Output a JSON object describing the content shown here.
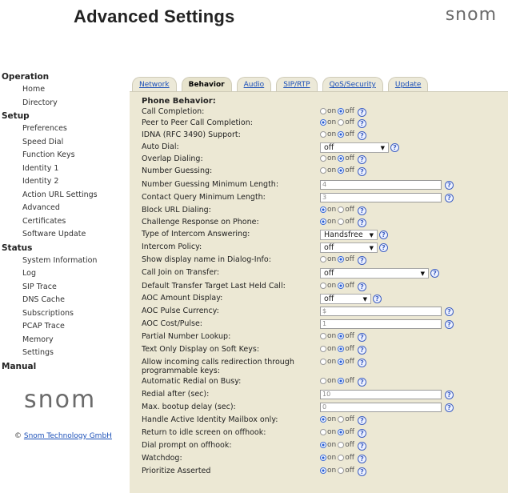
{
  "header": {
    "title": "Advanced Settings",
    "brand": "snom"
  },
  "sidebar": {
    "sections": [
      {
        "label": "Operation",
        "items": [
          "Home",
          "Directory"
        ]
      },
      {
        "label": "Setup",
        "items": [
          "Preferences",
          "Speed Dial",
          "Function Keys",
          "Identity 1",
          "Identity 2",
          "Action URL Settings",
          "Advanced",
          "Certificates",
          "Software Update"
        ]
      },
      {
        "label": "Status",
        "items": [
          "System Information",
          "Log",
          "SIP Trace",
          "DNS Cache",
          "Subscriptions",
          "PCAP Trace",
          "Memory",
          "Settings"
        ]
      },
      {
        "label": "Manual",
        "items": []
      }
    ],
    "logo": "snom",
    "copyright_symbol": "©",
    "copyright_link": "Snom Technology GmbH"
  },
  "tabs": [
    {
      "label": "Network",
      "active": false
    },
    {
      "label": "Behavior",
      "active": true
    },
    {
      "label": "Audio",
      "active": false
    },
    {
      "label": "SIP/RTP",
      "active": false
    },
    {
      "label": "QoS/Security",
      "active": false
    },
    {
      "label": "Update",
      "active": false
    }
  ],
  "section_title": "Phone Behavior:",
  "radio_labels": {
    "on": "on",
    "off": "off"
  },
  "help_glyph": "?",
  "settings": [
    {
      "label": "Call Completion:",
      "type": "radio",
      "value": "off"
    },
    {
      "label": "Peer to Peer Call Completion:",
      "type": "radio",
      "value": "on"
    },
    {
      "label": "IDNA (RFC 3490) Support:",
      "type": "radio",
      "value": "off"
    },
    {
      "label": "Auto Dial:",
      "type": "select",
      "value": "off"
    },
    {
      "label": "Overlap Dialing:",
      "type": "radio",
      "value": "off"
    },
    {
      "label": "Number Guessing:",
      "type": "radio",
      "value": "off"
    },
    {
      "label": "Number Guessing Minimum Length:",
      "type": "text",
      "value": "4"
    },
    {
      "label": "Contact Query Minimum Length:",
      "type": "text",
      "value": "3"
    },
    {
      "label": "Block URL Dialing:",
      "type": "radio",
      "value": "on"
    },
    {
      "label": "Challenge Response on Phone:",
      "type": "radio",
      "value": "on"
    },
    {
      "label": "Type of Intercom Answering:",
      "type": "select",
      "value": "Handsfree"
    },
    {
      "label": "Intercom Policy:",
      "type": "select",
      "value": "off"
    },
    {
      "label": "Show display name in Dialog-Info:",
      "type": "radio",
      "value": "off"
    },
    {
      "label": "Call Join on Transfer:",
      "type": "select",
      "value": "off"
    },
    {
      "label": "Default Transfer Target Last Held Call:",
      "type": "radio",
      "value": "off"
    },
    {
      "label": "AOC Amount Display:",
      "type": "select",
      "value": "off"
    },
    {
      "label": "AOC Pulse Currency:",
      "type": "text",
      "value": "$"
    },
    {
      "label": "AOC Cost/Pulse:",
      "type": "text",
      "value": "1"
    },
    {
      "label": "Partial Number Lookup:",
      "type": "radio",
      "value": "off"
    },
    {
      "label": "Text Only Display on Soft Keys:",
      "type": "radio",
      "value": "off"
    },
    {
      "label": "Allow incoming calls redirection through programmable keys:",
      "type": "radio",
      "value": "off"
    },
    {
      "label": "Automatic Redial on Busy:",
      "type": "radio",
      "value": "off"
    },
    {
      "label": "Redial after (sec):",
      "type": "text",
      "value": "10"
    },
    {
      "label": "Max. bootup delay (sec):",
      "type": "text",
      "value": "0"
    },
    {
      "label": "Handle Active Identity Mailbox only:",
      "type": "radio",
      "value": "on"
    },
    {
      "label": "Return to idle screen on offhook:",
      "type": "radio",
      "value": "off"
    },
    {
      "label": "Dial prompt on offhook:",
      "type": "radio",
      "value": "on"
    },
    {
      "label": "Watchdog:",
      "type": "radio",
      "value": "on"
    },
    {
      "label": "Prioritize Asserted",
      "type": "radio",
      "value": "on"
    }
  ]
}
